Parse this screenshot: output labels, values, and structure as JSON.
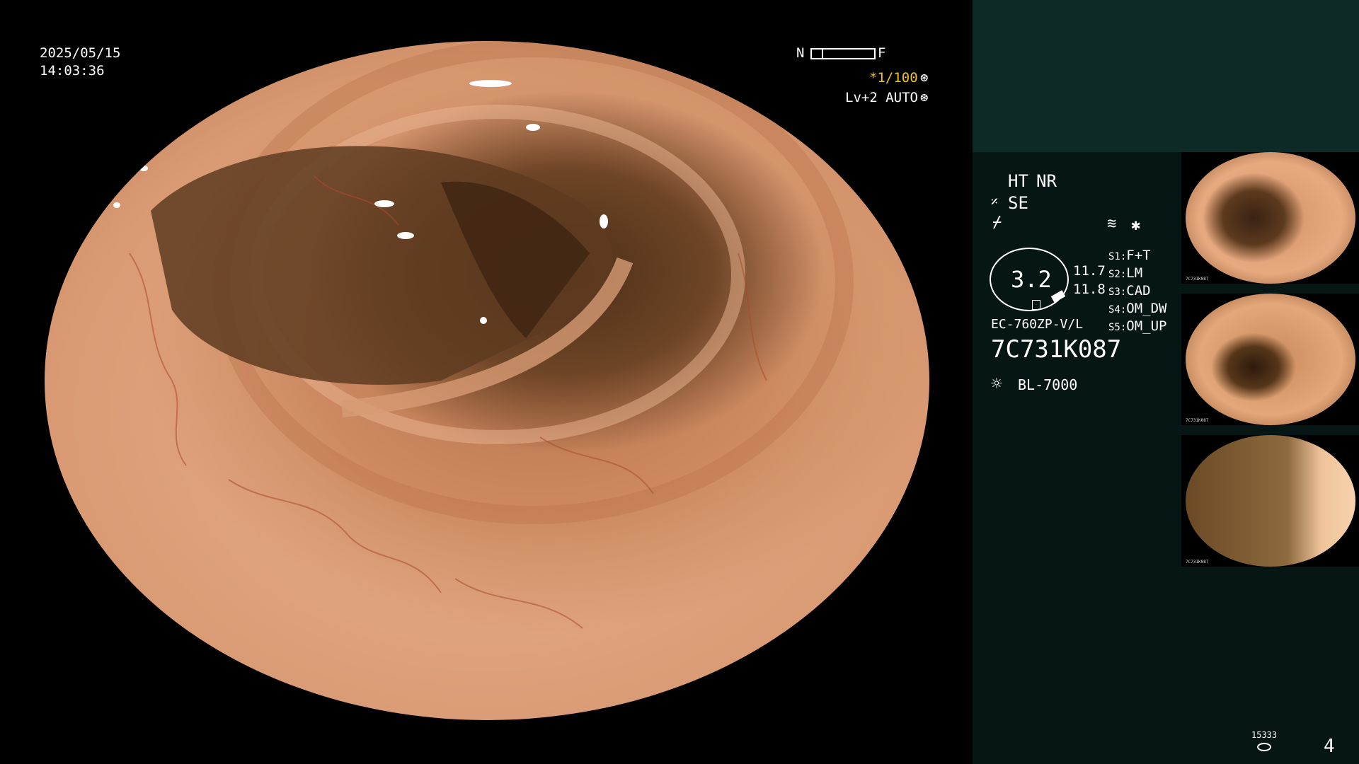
{
  "overlay": {
    "date": "2025/05/15",
    "time": "14:03:36",
    "focus_near": "N",
    "focus_far": "F",
    "shutter": "*1/100",
    "level_mode": "Lv+2 AUTO"
  },
  "panel": {
    "ht_label": "HT",
    "nr_label": "NR",
    "se_label": "SE",
    "s_settings": [
      {
        "key": "S1:",
        "value": "F+T"
      },
      {
        "key": "S2:",
        "value": "LM"
      },
      {
        "key": "S3:",
        "value": "CAD"
      },
      {
        "key": "S4:",
        "value": "OM_DW"
      },
      {
        "key": "S5:",
        "value": "OM_UP"
      }
    ],
    "zoom_value": "3.2",
    "reading_1": "11.7",
    "reading_2": "11.8",
    "scope_model": "EC-760ZP-V/L",
    "serial": "7C731K087",
    "light_source": "BL-7000",
    "storage_label": "15333",
    "image_count": "4"
  },
  "thumbnails": [
    {
      "tag": "7C731K087"
    },
    {
      "tag": "7C731K087"
    },
    {
      "tag": "7C731K087"
    }
  ],
  "colors": {
    "panel_top": "#0e2a26",
    "panel_bg": "#061614",
    "accent_yellow": "#f0c028"
  }
}
